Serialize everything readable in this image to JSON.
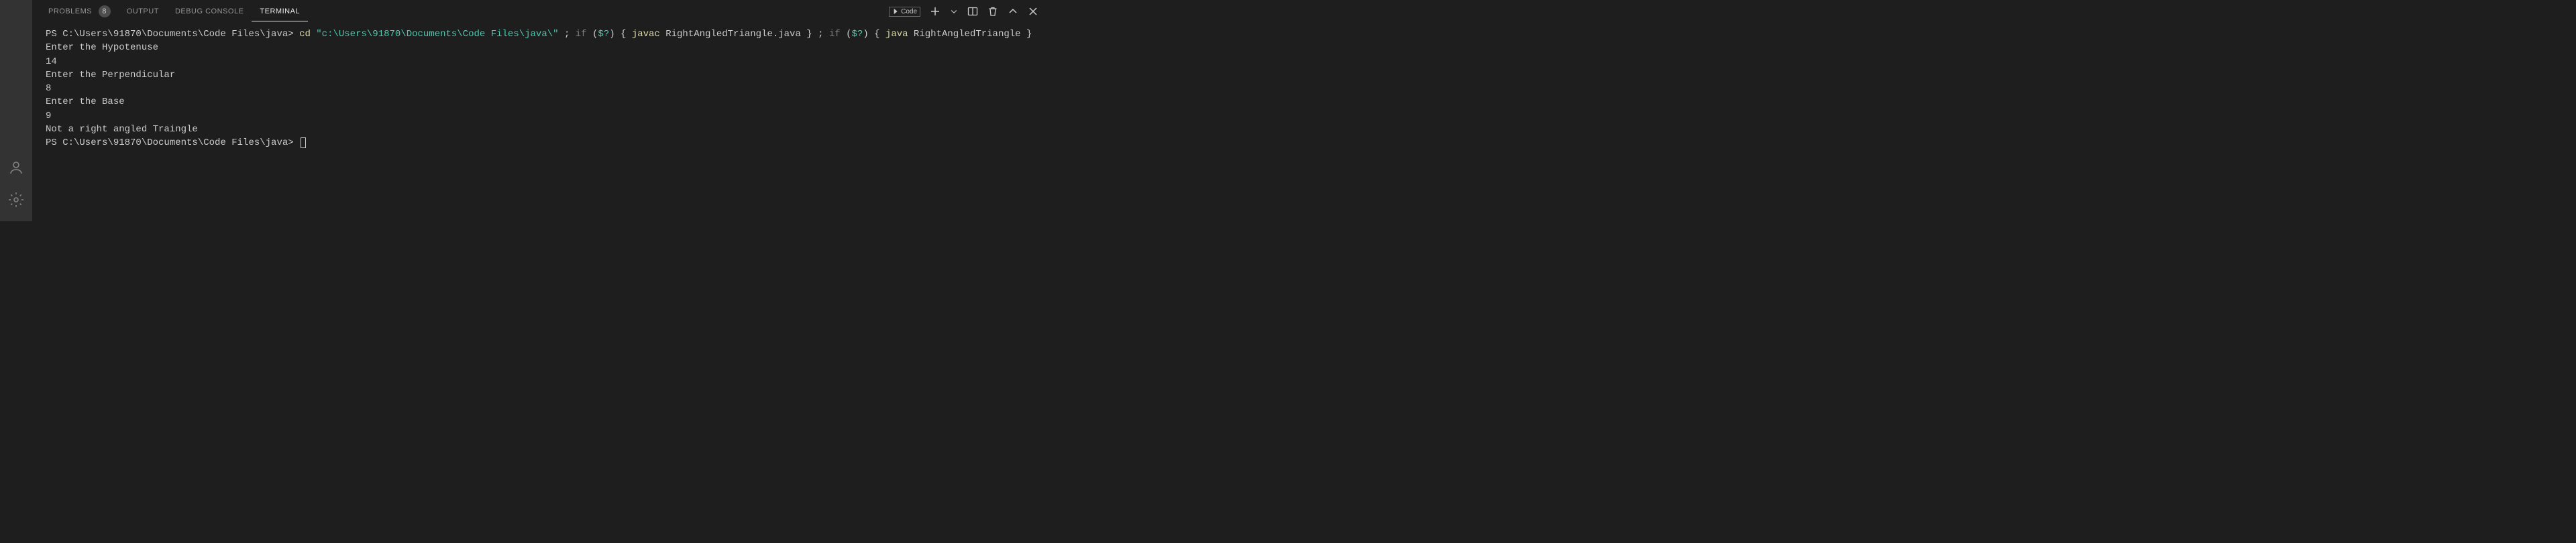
{
  "tabs": {
    "problems": "PROBLEMS",
    "problems_count": "8",
    "output": "OUTPUT",
    "debug_console": "DEBUG CONSOLE",
    "terminal": "TERMINAL"
  },
  "actions": {
    "profile_label": "Code"
  },
  "terminal": {
    "line1_prompt": "PS C:\\Users\\91870\\Documents\\Code Files\\java> ",
    "line1_cd": "cd",
    "line1_path": " \"c:\\Users\\91870\\Documents\\Code Files\\java\\\"",
    "line1_sep1": " ; ",
    "line1_if1": "if",
    "line1_cond1": " (",
    "line1_var1": "$?",
    "line1_cond1b": ") { ",
    "line1_javac": "javac",
    "line1_file": " RightAngledTriangle.java ",
    "line1_brace1": "} ; ",
    "line1_if2": "if",
    "line1_cond2": " (",
    "line1_var2": "$?",
    "line1_cond2b": ") { ",
    "line1_java": "java",
    "line1_class": " RightAngledTriangle ",
    "line1_brace2": "}",
    "line2": "Enter the Hypotenuse",
    "line3": "14",
    "line4": "Enter the Perpendicular",
    "line5": "8",
    "line6": "Enter the Base",
    "line7": "9",
    "line8": "Not a right angled Traingle",
    "line9_prompt": "PS C:\\Users\\91870\\Documents\\Code Files\\java> "
  }
}
